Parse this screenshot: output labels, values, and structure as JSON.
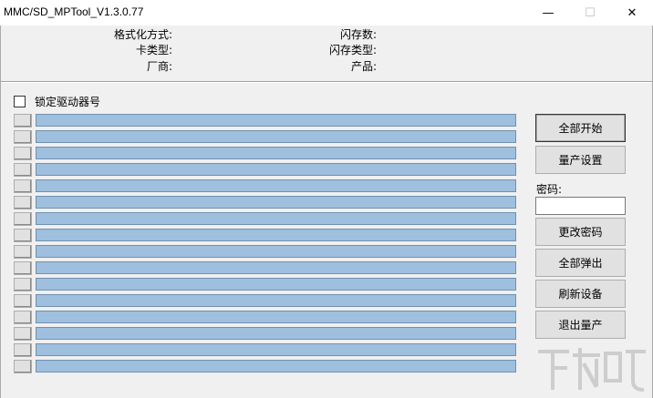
{
  "window": {
    "title": "MMC/SD_MPTool_V1.3.0.77",
    "min_glyph": "—",
    "max_glyph": "☐",
    "close_glyph": "✕"
  },
  "info": {
    "format_label": "格式化方式:",
    "card_type_label": "卡类型:",
    "vendor_label": "厂商:",
    "flash_count_label": "闪存数:",
    "flash_type_label": "闪存类型:",
    "product_label": "产品:"
  },
  "lock_drive_label": "锁定驱动器号",
  "port_count": 16,
  "buttons": {
    "start_all": "全部开始",
    "mp_settings": "量产设置",
    "password_label": "密码:",
    "change_password": "更改密码",
    "eject_all": "全部弹出",
    "refresh_devices": "刷新设备",
    "exit_mp": "退出量产"
  },
  "colors": {
    "progress_fill": "#9fbfdf",
    "window_bg": "#f0f0f0"
  }
}
